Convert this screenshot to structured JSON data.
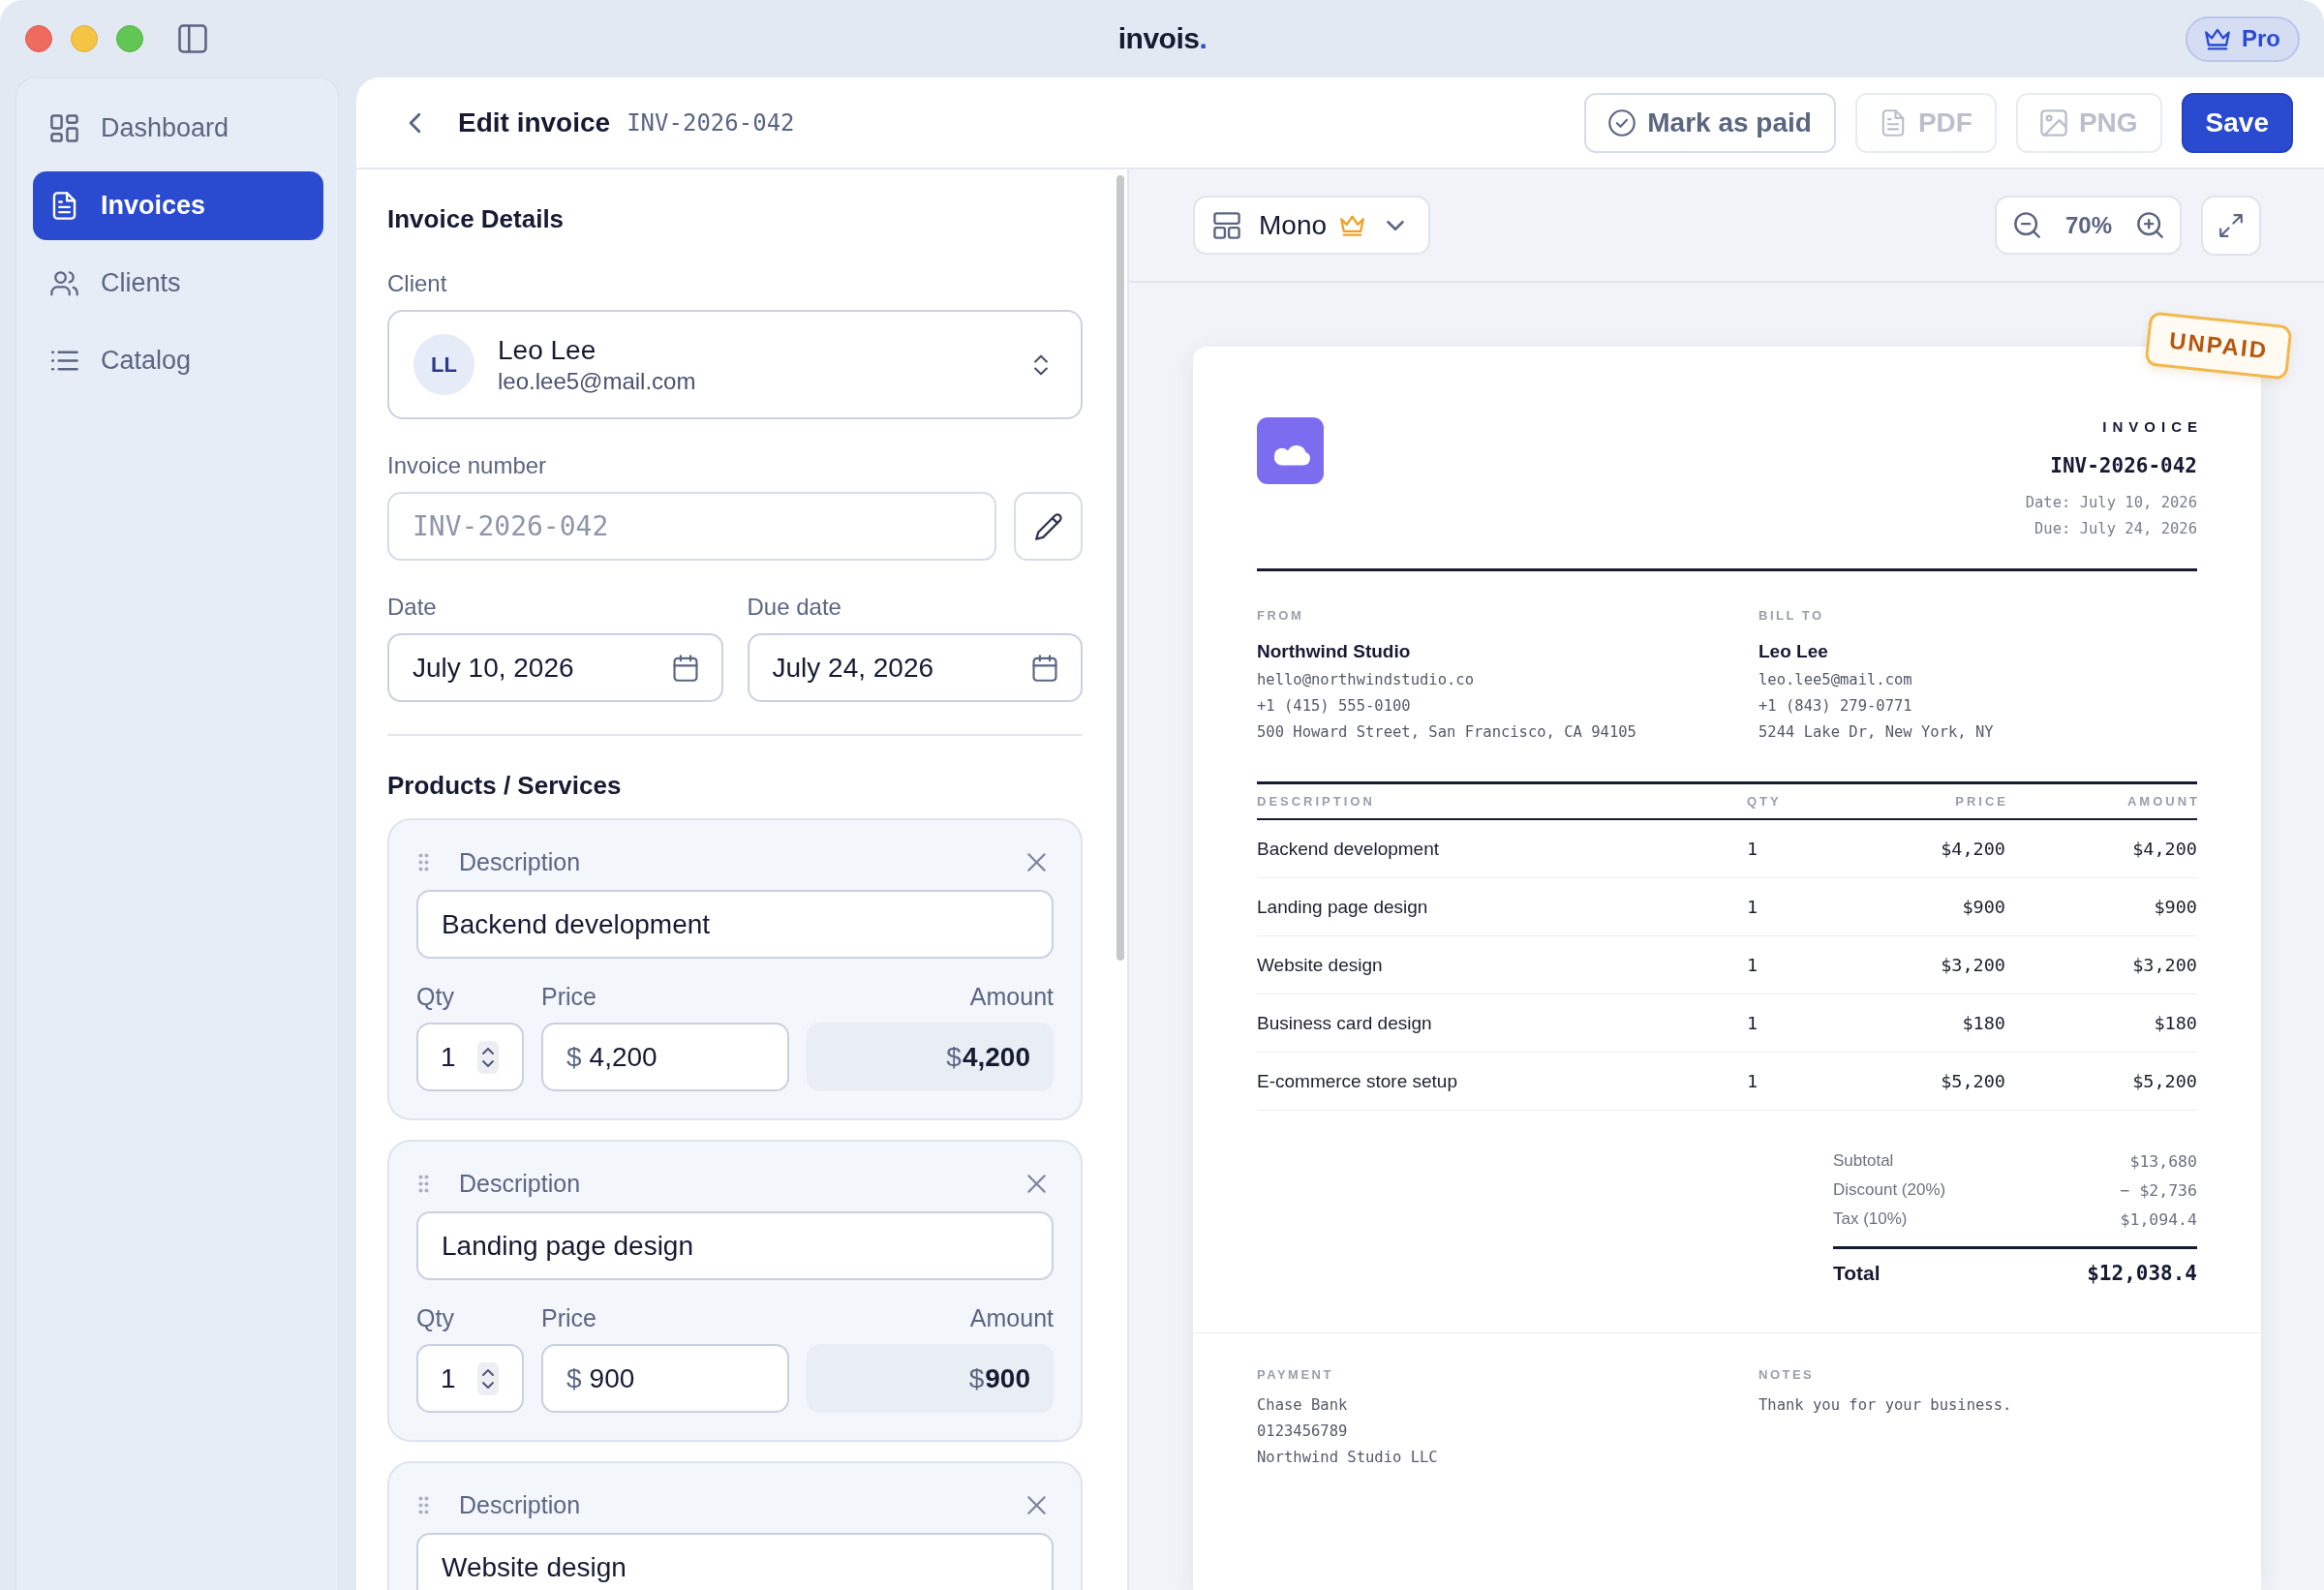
{
  "titlebar": {
    "app_name": "invois.",
    "pro_button": "Pro"
  },
  "sidebar": {
    "items": [
      {
        "label": "Dashboard",
        "selected": false
      },
      {
        "label": "Invoices",
        "selected": true
      },
      {
        "label": "Clients",
        "selected": false
      },
      {
        "label": "Catalog",
        "selected": false
      }
    ]
  },
  "header": {
    "title": "Edit invoice",
    "invoice_id": "INV-2026-042",
    "mark_paid_button": {
      "label": "Mark as paid",
      "disabled": false
    },
    "pdf_button": {
      "label": "PDF",
      "disabled": true
    },
    "png_button": {
      "label": "PNG",
      "disabled": true
    },
    "save_button": {
      "label": "Save"
    }
  },
  "form": {
    "title": "Invoice Details",
    "client": {
      "label": "Client",
      "initials": "LL",
      "name": "Leo Lee",
      "email": "leo.lee5@mail.com"
    },
    "invoice_number": {
      "label": "Invoice number",
      "value": "INV-2026-042",
      "disabled": true
    },
    "date": {
      "label": "Date",
      "value": "July 10, 2026"
    },
    "due_date": {
      "label": "Due date",
      "value": "July 24, 2026"
    },
    "products_title": "Products / Services",
    "items": [
      {
        "description_label": "Description",
        "description": "Backend development",
        "qty_label": "Qty",
        "qty": "1",
        "price_label": "Price",
        "price_currency": "$",
        "price": "4,200",
        "amount_label": "Amount",
        "amount_currency": "$",
        "amount": "4,200"
      },
      {
        "description_label": "Description",
        "description": "Landing page design",
        "qty_label": "Qty",
        "qty": "1",
        "price_label": "Price",
        "price_currency": "$",
        "price": "900",
        "amount_label": "Amount",
        "amount_currency": "$",
        "amount": "900"
      },
      {
        "description_label": "Description",
        "description": "Website design"
      }
    ]
  },
  "preview": {
    "template": "Mono",
    "zoom": "70%",
    "invoice": {
      "status": "UNPAID",
      "title": "INVOICE",
      "number": "INV-2026-042",
      "date_line": "Date: July 10, 2026",
      "due_line": "Due: July 24, 2026",
      "from": {
        "label": "FROM",
        "name": "Northwind Studio",
        "lines": [
          "hello@northwindstudio.co",
          "+1 (415) 555-0100",
          "500 Howard Street, San Francisco, CA 94105"
        ]
      },
      "bill_to": {
        "label": "BILL TO",
        "name": "Leo Lee",
        "lines": [
          "leo.lee5@mail.com",
          "+1 (843) 279-0771",
          "5244 Lake Dr, New York, NY"
        ]
      },
      "columns": [
        "DESCRIPTION",
        "QTY",
        "PRICE",
        "AMOUNT"
      ],
      "rows": [
        {
          "description": "Backend development",
          "qty": "1",
          "price": "$4,200",
          "amount": "$4,200"
        },
        {
          "description": "Landing page design",
          "qty": "1",
          "price": "$900",
          "amount": "$900"
        },
        {
          "description": "Website design",
          "qty": "1",
          "price": "$3,200",
          "amount": "$3,200"
        },
        {
          "description": "Business card design",
          "qty": "1",
          "price": "$180",
          "amount": "$180"
        },
        {
          "description": "E-commerce store setup",
          "qty": "1",
          "price": "$5,200",
          "amount": "$5,200"
        }
      ],
      "totals": [
        {
          "label": "Subtotal",
          "value": "$13,680"
        },
        {
          "label": "Discount (20%)",
          "value": "− $2,736"
        },
        {
          "label": "Tax (10%)",
          "value": "$1,094.4"
        }
      ],
      "total": {
        "label": "Total",
        "value": "$12,038.4"
      },
      "payment": {
        "label": "PAYMENT",
        "lines": [
          "Chase Bank",
          "0123456789",
          "Northwind Studio LLC"
        ]
      },
      "notes": {
        "label": "NOTES",
        "text": "Thank you for your business."
      }
    }
  }
}
